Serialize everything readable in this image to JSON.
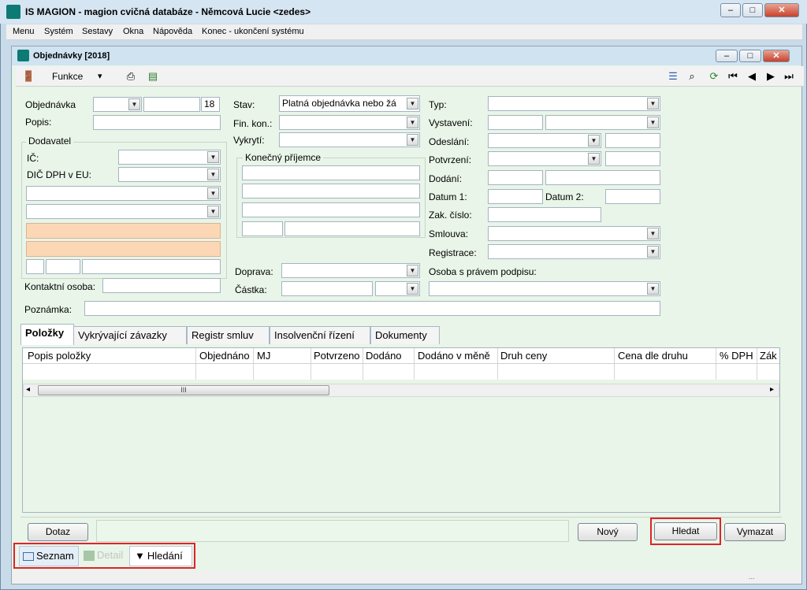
{
  "app": {
    "title": "IS MAGION - magion cvičná databáze - Němcová Lucie <zedes>",
    "window_buttons": [
      "–",
      "□",
      "✕"
    ]
  },
  "menu": {
    "items": [
      "Menu",
      "Systém",
      "Sestavy",
      "Okna",
      "Nápověda",
      "Konec - ukončení systému"
    ]
  },
  "inner_window": {
    "title": "Objednávky [2018]"
  },
  "toolbar": {
    "funkce_label": "Funkce",
    "funkce_arrow": "▾"
  },
  "form": {
    "objednavka_label": "Objednávka",
    "objednavka_year": "18",
    "popis_label": "Popis:",
    "dodavatel_label": "Dodavatel",
    "ic_label": "IČ:",
    "dic_label": "DIČ DPH v EU:",
    "kontaktni_osoba_label": "Kontaktní osoba:",
    "stav_label": "Stav:",
    "stav_value": "Platná objednávka nebo žá",
    "fin_kon_label": "Fin. kon.:",
    "vykryti_label": "Vykrytí:",
    "konecny_prijemce_label": "Konečný příjemce",
    "doprava_label": "Doprava:",
    "castka_label": "Částka:",
    "typ_label": "Typ:",
    "vystaveni_label": "Vystavení:",
    "odeslani_label": "Odeslání:",
    "potvrzeni_label": "Potvrzení:",
    "dodani_label": "Dodání:",
    "datum1_label": "Datum 1:",
    "datum2_label": "Datum 2:",
    "zak_cislo_label": "Zak. číslo:",
    "smlouva_label": "Smlouva:",
    "registrace_label": "Registrace:",
    "osoba_podpis_label": "Osoba s právem podpisu:",
    "poznamka_label": "Poznámka:"
  },
  "tabs": [
    "Položky",
    "Vykrývající závazky",
    "Registr smluv",
    "Insolvenční řízení",
    "Dokumenty"
  ],
  "grid": {
    "columns": [
      "Popis položky",
      "Objednáno",
      "MJ",
      "Potvrzeno",
      "Dodáno",
      "Dodáno v měně",
      "Druh ceny",
      "Cena dle druhu",
      "% DPH",
      "Zák"
    ],
    "scroll_left": "◂",
    "scroll_right": "▸",
    "thumb_grip": "III"
  },
  "buttons": {
    "dotaz": "Dotaz",
    "novy": "Nový",
    "hledat": "Hledat",
    "vymazat": "Vymazat"
  },
  "bottom_tabs": {
    "seznam": "Seznam",
    "detail": "Detail",
    "hledani": "Hledání"
  },
  "status": {
    "text": "..."
  },
  "colors": {
    "panel_bg": "#e8f5e8",
    "highlight_red": "#e0222a",
    "peach_field": "#fcd7b5",
    "logo_teal": "#0e7a74"
  }
}
